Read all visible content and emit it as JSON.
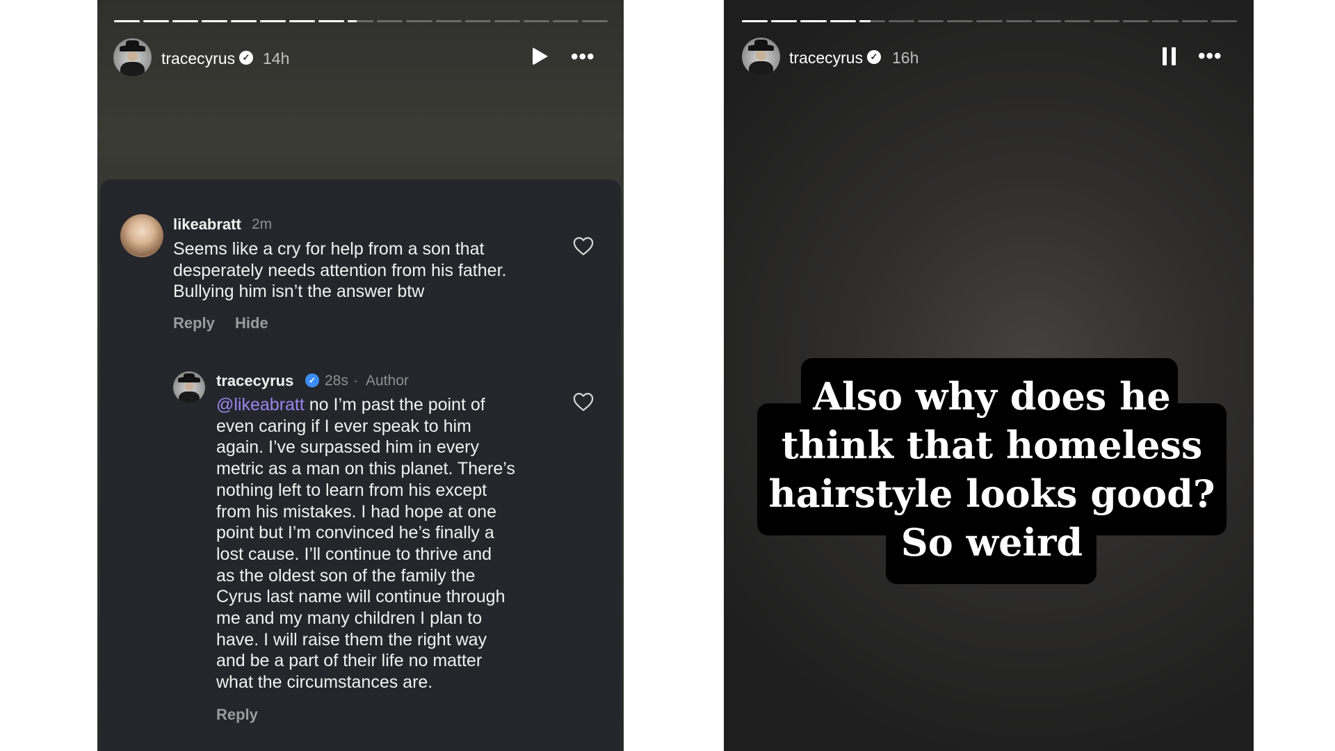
{
  "left_story": {
    "username": "tracecyrus",
    "time": "14h",
    "progress": {
      "segments": 17,
      "completed": 8,
      "current_fill": 0.35
    },
    "controls": {
      "play_icon": "play-icon",
      "more_icon": "more-horizontal-icon"
    },
    "comments": [
      {
        "username": "likeabratt",
        "time": "2m",
        "lines": [
          "Seems like a cry for help from a son that",
          "desperately needs attention from his father.",
          "Bullying him isn’t the answer btw"
        ],
        "actions": {
          "reply": "Reply",
          "hide": "Hide"
        }
      }
    ],
    "reply": {
      "username": "tracecyrus",
      "time": "28s",
      "separator": "·",
      "badge": "Author",
      "mention": "@likeabratt",
      "first_line_rest": " no I’m past the point of",
      "lines": [
        "even caring if I ever speak to him",
        "again. I’ve surpassed him in every",
        "metric as a man on this planet. There’s",
        "nothing left to learn from his except",
        "from his mistakes. I had hope at one",
        "point but I’m convinced he’s finally a",
        "lost cause. I’ll continue to thrive and",
        "as the oldest son of the family the",
        "Cyrus last name will continue through",
        "me and my many children I plan to",
        "have. I will raise them the right way",
        "and be a part of their life no matter",
        "what the circumstances are."
      ],
      "action_reply": "Reply"
    }
  },
  "right_story": {
    "username": "tracecyrus",
    "time": "16h",
    "progress": {
      "segments": 17,
      "completed": 4,
      "current_fill": 0.45
    },
    "controls": {
      "pause_icon": "pause-icon",
      "more_icon": "more-horizontal-icon"
    },
    "caption_lines": [
      "Also why does he",
      "think that homeless",
      "hairstyle looks good?",
      "So weird"
    ]
  }
}
